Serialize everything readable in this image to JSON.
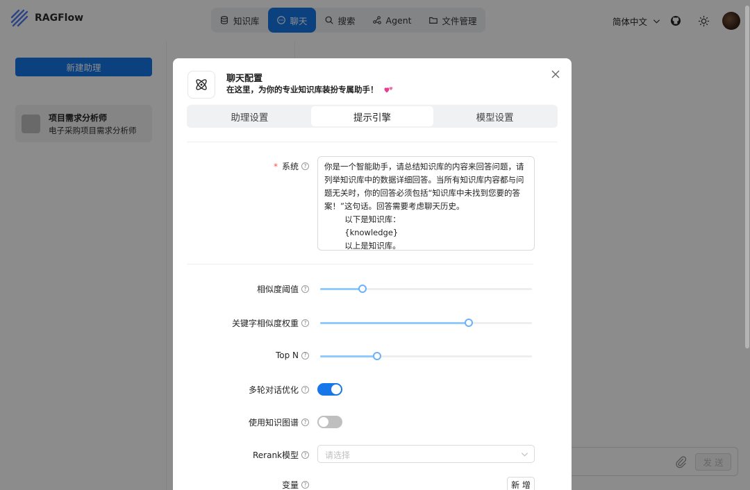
{
  "app": {
    "name": "RAGFlow"
  },
  "nav": {
    "items": [
      {
        "label": "知识库",
        "icon": "database-icon",
        "active": false
      },
      {
        "label": "聊天",
        "icon": "chat-bubble-icon",
        "active": true
      },
      {
        "label": "搜索",
        "icon": "search-icon",
        "active": false
      },
      {
        "label": "Agent",
        "icon": "agent-graph-icon",
        "active": false
      },
      {
        "label": "文件管理",
        "icon": "folder-icon",
        "active": false
      }
    ]
  },
  "header": {
    "language": "简体中文",
    "github_icon": "github-icon",
    "theme_icon": "sun-icon"
  },
  "sidebar": {
    "new_button": "新建助理",
    "assistant": {
      "name": "项目需求分析师",
      "description": "电子采购项目需求分析师"
    }
  },
  "chat": {
    "send_label": "发 送"
  },
  "modal": {
    "title": "聊天配置",
    "subtitle": "在这里，为你的专业知识库装扮专属助手！",
    "tabs": [
      {
        "label": "助理设置",
        "active": false
      },
      {
        "label": "提示引擎",
        "active": true
      },
      {
        "label": "模型设置",
        "active": false
      }
    ],
    "system": {
      "label": "系统",
      "required": true,
      "value": "你是一个智能助手，请总结知识库的内容来回答问题，请列举知识库中的数据详细回答。当所有知识库内容都与问题无关时，你的回答必须包括“知识库中未找到您要的答案！”这句话。回答需要考虑聊天历史。\n        以下是知识库：\n        {knowledge}\n        以上是知识库。"
    },
    "similarity_threshold": {
      "label": "相似度阈值",
      "fraction": 0.2
    },
    "keyword_weight": {
      "label": "关键字相似度权重",
      "fraction": 0.7
    },
    "top_n": {
      "label": "Top N",
      "fraction": 0.27
    },
    "multi_turn": {
      "label": "多轮对话优化",
      "on": true
    },
    "knowledge_graph": {
      "label": "使用知识图谱",
      "on": false
    },
    "rerank": {
      "label": "Rerank模型",
      "placeholder": "请选择"
    },
    "variables": {
      "label": "变量",
      "add_label": "新 增"
    }
  },
  "colors": {
    "primary": "#1677e8",
    "slider_track": "#91caff",
    "required": "#ff4d4f"
  }
}
